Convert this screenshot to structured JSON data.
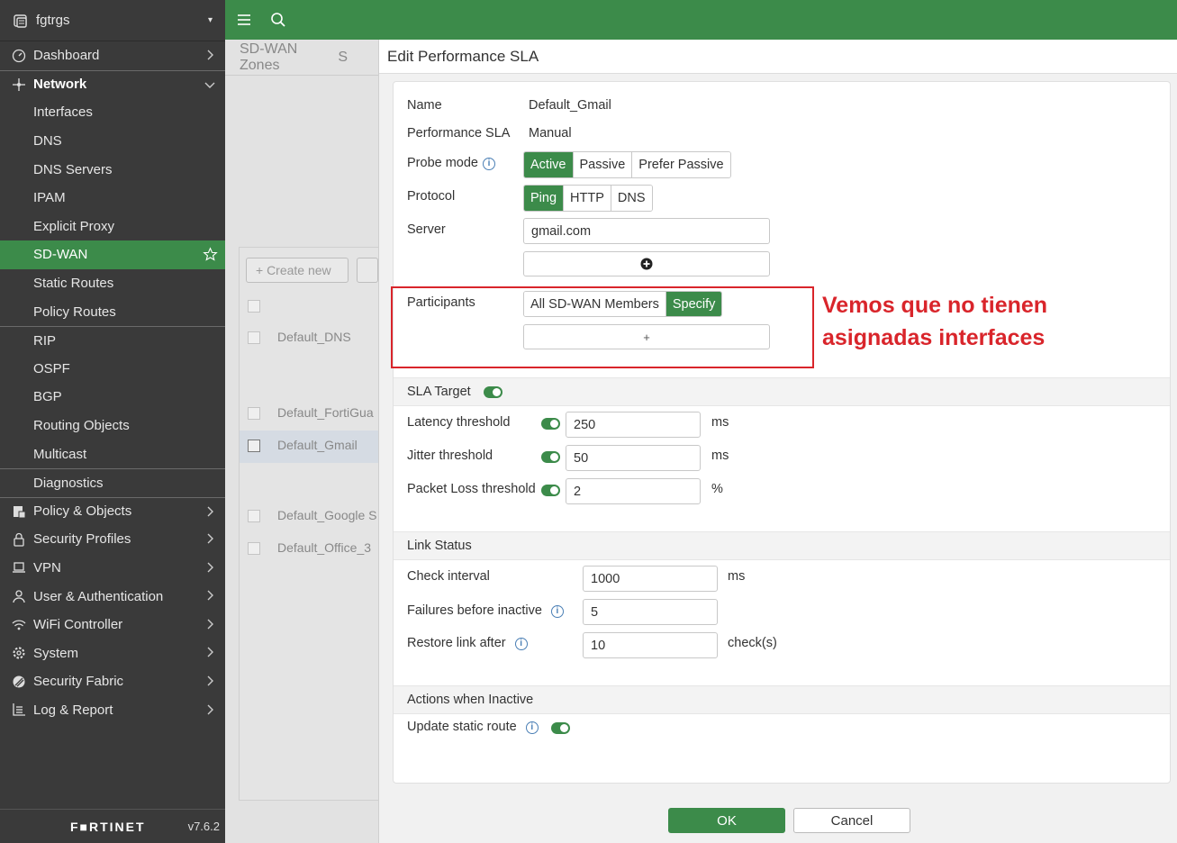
{
  "device": {
    "name": "fgtrgs",
    "caret": "▾"
  },
  "sidebar": {
    "items": [
      {
        "label": "Dashboard"
      },
      {
        "label": "Network"
      },
      {
        "label": "Interfaces"
      },
      {
        "label": "DNS"
      },
      {
        "label": "DNS Servers"
      },
      {
        "label": "IPAM"
      },
      {
        "label": "Explicit Proxy"
      },
      {
        "label": "SD-WAN"
      },
      {
        "label": "Static Routes"
      },
      {
        "label": "Policy Routes"
      },
      {
        "label": "RIP"
      },
      {
        "label": "OSPF"
      },
      {
        "label": "BGP"
      },
      {
        "label": "Routing Objects"
      },
      {
        "label": "Multicast"
      },
      {
        "label": "Diagnostics"
      },
      {
        "label": "Policy & Objects"
      },
      {
        "label": "Security Profiles"
      },
      {
        "label": "VPN"
      },
      {
        "label": "User & Authentication"
      },
      {
        "label": "WiFi Controller"
      },
      {
        "label": "System"
      },
      {
        "label": "Security Fabric"
      },
      {
        "label": "Log & Report"
      }
    ],
    "brand": "F■RTINET",
    "version": "v7.6.2"
  },
  "background": {
    "tabs": [
      "SD-WAN Zones",
      "S"
    ],
    "create_label": "+ Create new",
    "rows": [
      "Default_DNS",
      "Default_FortiGua",
      "Default_Gmail",
      "Default_Google S",
      "Default_Office_3"
    ]
  },
  "dialog": {
    "title": "Edit Performance SLA",
    "name_label": "Name",
    "name_value": "Default_Gmail",
    "sla_label": "Performance SLA",
    "sla_value": "Manual",
    "probe_label": "Probe mode",
    "probe_options": [
      "Active",
      "Passive",
      "Prefer Passive"
    ],
    "protocol_label": "Protocol",
    "protocol_options": [
      "Ping",
      "HTTP",
      "DNS"
    ],
    "server_label": "Server",
    "server_value": "gmail.com",
    "participants_label": "Participants",
    "participants_options": [
      "All SD-WAN Members",
      "Specify"
    ],
    "plus_symbol": "+",
    "sla_target_label": "SLA Target",
    "latency_label": "Latency threshold",
    "latency_value": "250",
    "latency_unit": "ms",
    "jitter_label": "Jitter threshold",
    "jitter_value": "50",
    "jitter_unit": "ms",
    "loss_label": "Packet Loss threshold",
    "loss_value": "2",
    "loss_unit": "%",
    "link_status_label": "Link Status",
    "check_interval_label": "Check interval",
    "check_interval_value": "1000",
    "check_interval_unit": "ms",
    "failures_label": "Failures before inactive",
    "failures_value": "5",
    "restore_label": "Restore link after",
    "restore_value": "10",
    "restore_unit": "check(s)",
    "actions_label": "Actions when Inactive",
    "update_route_label": "Update static route",
    "ok_label": "OK",
    "cancel_label": "Cancel"
  },
  "annotation": {
    "line1": "Vemos que no tienen",
    "line2": "asignadas interfaces",
    "color": "#d9252b"
  },
  "colors": {
    "accent": "#3c8b4a",
    "sidebar": "#3a3a3a"
  }
}
